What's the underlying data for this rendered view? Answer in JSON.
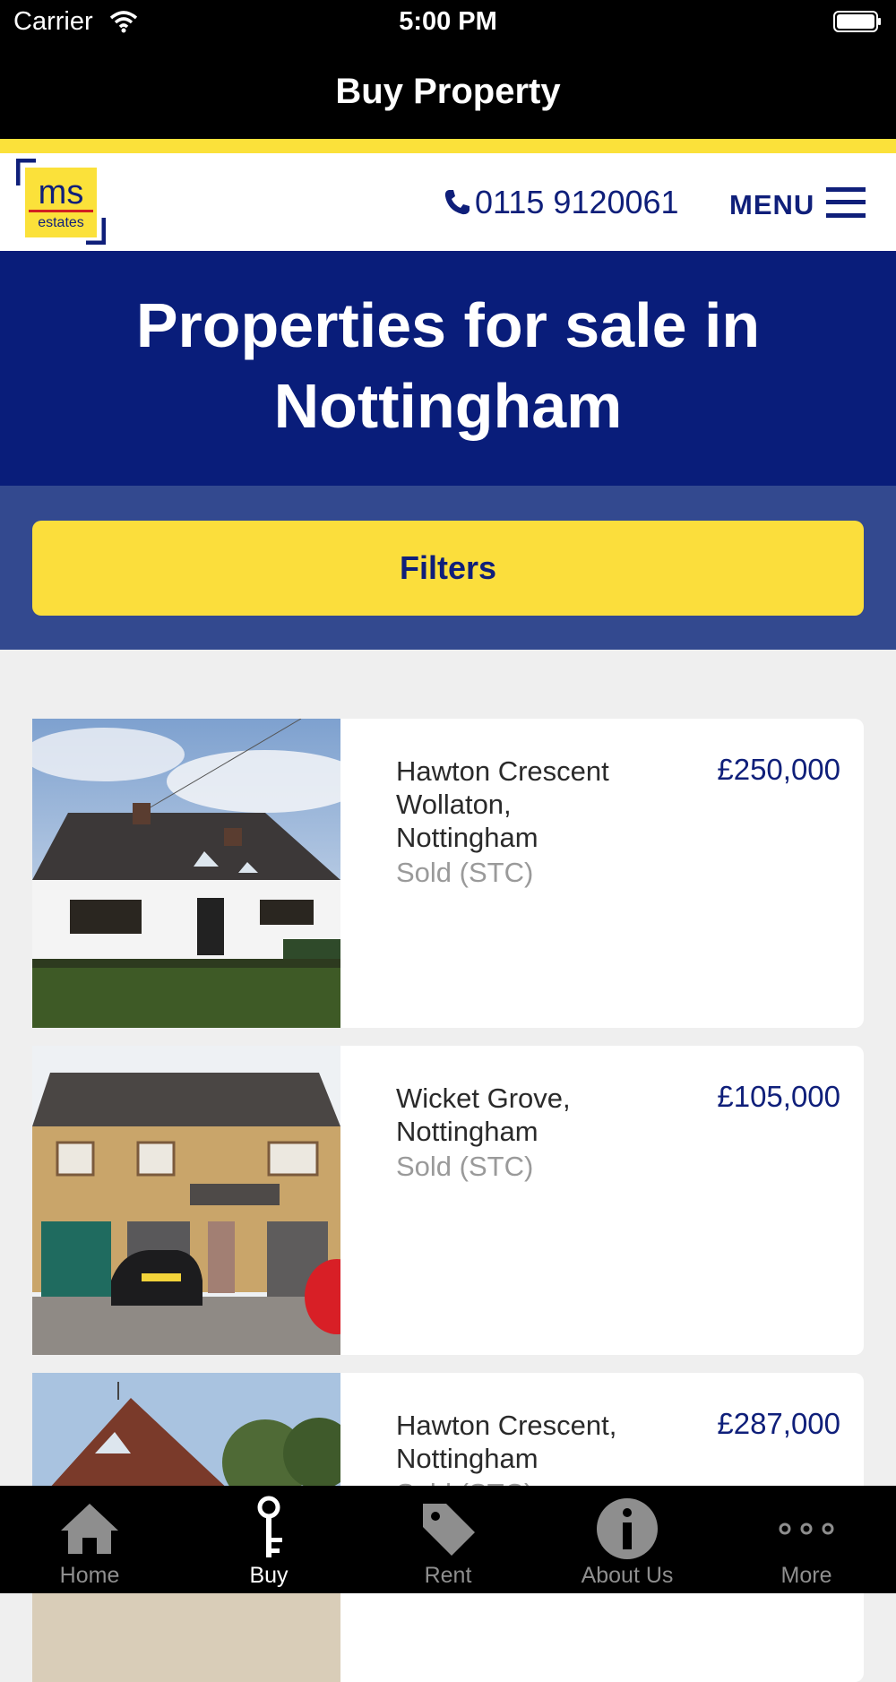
{
  "status_bar": {
    "carrier": "Carrier",
    "time": "5:00 PM"
  },
  "nav": {
    "title": "Buy Property"
  },
  "header": {
    "logo_text_top": "ms",
    "logo_text_bottom": "estates",
    "phone": "0115 9120061",
    "menu_label": "MENU"
  },
  "hero": {
    "title": "Properties for sale in Nottingham"
  },
  "filters": {
    "label": "Filters"
  },
  "listings": [
    {
      "address": "Hawton Crescent Wollaton, Nottingham",
      "status": "Sold (STC)",
      "price": "£250,000"
    },
    {
      "address": "Wicket Grove, Nottingham",
      "status": "Sold (STC)",
      "price": "£105,000"
    },
    {
      "address": "Hawton Crescent, Nottingham",
      "status": "Sold (STC)",
      "price": "£287,000"
    }
  ],
  "tabs": [
    {
      "label": "Home",
      "icon": "home-icon"
    },
    {
      "label": "Buy",
      "icon": "key-icon"
    },
    {
      "label": "Rent",
      "icon": "tag-icon"
    },
    {
      "label": "About Us",
      "icon": "info-icon"
    },
    {
      "label": "More",
      "icon": "more-dots-icon"
    }
  ],
  "colors": {
    "brand_blue": "#091d7a",
    "brand_yellow": "#fbe13a",
    "filter_bg": "#33498f"
  }
}
